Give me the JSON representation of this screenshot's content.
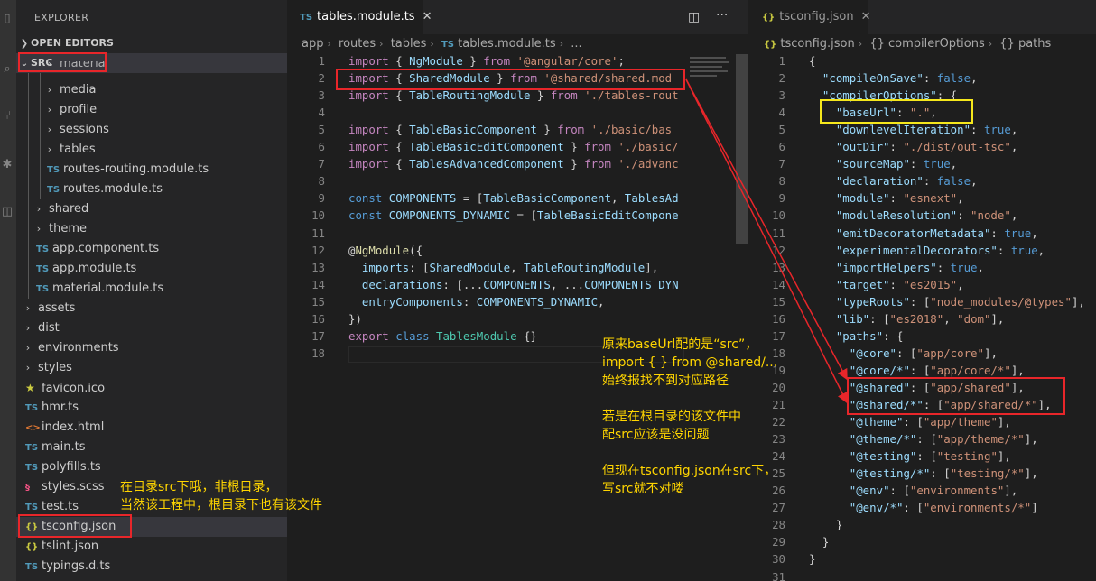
{
  "sidebar": {
    "title": "EXPLORER",
    "sections": {
      "open_editors": "OPEN EDITORS",
      "root": "SRC"
    },
    "tree": [
      {
        "label": "material",
        "type": "folder",
        "depth": 2
      },
      {
        "label": "media",
        "type": "folder",
        "depth": 2
      },
      {
        "label": "profile",
        "type": "folder",
        "depth": 2
      },
      {
        "label": "sessions",
        "type": "folder",
        "depth": 2
      },
      {
        "label": "tables",
        "type": "folder",
        "depth": 2
      },
      {
        "label": "routes-routing.module.ts",
        "type": "ts",
        "depth": 2
      },
      {
        "label": "routes.module.ts",
        "type": "ts",
        "depth": 2
      },
      {
        "label": "shared",
        "type": "folder",
        "depth": 1
      },
      {
        "label": "theme",
        "type": "folder",
        "depth": 1
      },
      {
        "label": "app.component.ts",
        "type": "ts",
        "depth": 1
      },
      {
        "label": "app.module.ts",
        "type": "ts",
        "depth": 1
      },
      {
        "label": "material.module.ts",
        "type": "ts",
        "depth": 1
      },
      {
        "label": "assets",
        "type": "folder",
        "depth": 0
      },
      {
        "label": "dist",
        "type": "folder",
        "depth": 0
      },
      {
        "label": "environments",
        "type": "folder",
        "depth": 0
      },
      {
        "label": "styles",
        "type": "folder",
        "depth": 0
      },
      {
        "label": "favicon.ico",
        "type": "star",
        "depth": 0
      },
      {
        "label": "hmr.ts",
        "type": "ts",
        "depth": 0
      },
      {
        "label": "index.html",
        "type": "html",
        "depth": 0
      },
      {
        "label": "main.ts",
        "type": "ts",
        "depth": 0
      },
      {
        "label": "polyfills.ts",
        "type": "ts",
        "depth": 0
      },
      {
        "label": "styles.scss",
        "type": "scss",
        "depth": 0
      },
      {
        "label": "test.ts",
        "type": "ts",
        "depth": 0
      },
      {
        "label": "tsconfig.json",
        "type": "json",
        "depth": 0
      },
      {
        "label": "tslint.json",
        "type": "json",
        "depth": 0
      },
      {
        "label": "typings.d.ts",
        "type": "ts",
        "depth": 0
      }
    ],
    "icon_text": {
      "ts": "TS",
      "json": "{}",
      "html": "<>",
      "scss": "§",
      "star": "★"
    }
  },
  "editor_left": {
    "tab_label": "tables.module.ts",
    "tab_icon": "TS",
    "breadcrumb": [
      "app",
      "routes",
      "tables",
      "tables.module.ts",
      "..."
    ],
    "line_numbers": [
      "1",
      "2",
      "3",
      "4",
      "5",
      "6",
      "7",
      "8",
      "9",
      "10",
      "11",
      "12",
      "13",
      "14",
      "15",
      "16",
      "17",
      "18"
    ],
    "lines": [
      [
        {
          "t": "import",
          "c": "kw"
        },
        {
          "t": " { ",
          "c": "txt"
        },
        {
          "t": "NgModule",
          "c": "vr"
        },
        {
          "t": " } ",
          "c": "txt"
        },
        {
          "t": "from",
          "c": "kw"
        },
        {
          "t": " ",
          "c": "txt"
        },
        {
          "t": "'@angular/core'",
          "c": "str"
        },
        {
          "t": ";",
          "c": "txt"
        }
      ],
      [
        {
          "t": "import",
          "c": "kw"
        },
        {
          "t": " { ",
          "c": "txt"
        },
        {
          "t": "SharedModule",
          "c": "vr"
        },
        {
          "t": " } ",
          "c": "txt"
        },
        {
          "t": "from",
          "c": "kw"
        },
        {
          "t": " ",
          "c": "txt"
        },
        {
          "t": "'@shared/shared.mod",
          "c": "str"
        }
      ],
      [
        {
          "t": "import",
          "c": "kw"
        },
        {
          "t": " { ",
          "c": "txt"
        },
        {
          "t": "TableRoutingModule",
          "c": "vr"
        },
        {
          "t": " } ",
          "c": "txt"
        },
        {
          "t": "from",
          "c": "kw"
        },
        {
          "t": " ",
          "c": "txt"
        },
        {
          "t": "'./tables-rout",
          "c": "str"
        }
      ],
      [],
      [
        {
          "t": "import",
          "c": "kw"
        },
        {
          "t": " { ",
          "c": "txt"
        },
        {
          "t": "TableBasicComponent",
          "c": "vr"
        },
        {
          "t": " } ",
          "c": "txt"
        },
        {
          "t": "from",
          "c": "kw"
        },
        {
          "t": " ",
          "c": "txt"
        },
        {
          "t": "'./basic/bas",
          "c": "str"
        }
      ],
      [
        {
          "t": "import",
          "c": "kw"
        },
        {
          "t": " { ",
          "c": "txt"
        },
        {
          "t": "TableBasicEditComponent",
          "c": "vr"
        },
        {
          "t": " } ",
          "c": "txt"
        },
        {
          "t": "from",
          "c": "kw"
        },
        {
          "t": " ",
          "c": "txt"
        },
        {
          "t": "'./basic/",
          "c": "str"
        }
      ],
      [
        {
          "t": "import",
          "c": "kw"
        },
        {
          "t": " { ",
          "c": "txt"
        },
        {
          "t": "TablesAdvancedComponent",
          "c": "vr"
        },
        {
          "t": " } ",
          "c": "txt"
        },
        {
          "t": "from",
          "c": "kw"
        },
        {
          "t": " ",
          "c": "txt"
        },
        {
          "t": "'./advanc",
          "c": "str"
        }
      ],
      [],
      [
        {
          "t": "const",
          "c": "kb"
        },
        {
          "t": " ",
          "c": "txt"
        },
        {
          "t": "COMPONENTS",
          "c": "vr"
        },
        {
          "t": " = [",
          "c": "txt"
        },
        {
          "t": "TableBasicComponent",
          "c": "vr"
        },
        {
          "t": ", ",
          "c": "txt"
        },
        {
          "t": "TablesAd",
          "c": "vr"
        }
      ],
      [
        {
          "t": "const",
          "c": "kb"
        },
        {
          "t": " ",
          "c": "txt"
        },
        {
          "t": "COMPONENTS_DYNAMIC",
          "c": "vr"
        },
        {
          "t": " = [",
          "c": "txt"
        },
        {
          "t": "TableBasicEditCompone",
          "c": "vr"
        }
      ],
      [],
      [
        {
          "t": "@",
          "c": "txt"
        },
        {
          "t": "NgModule",
          "c": "fn"
        },
        {
          "t": "({",
          "c": "txt"
        }
      ],
      [
        {
          "t": "  ",
          "c": "txt"
        },
        {
          "t": "imports",
          "c": "vr"
        },
        {
          "t": ": [",
          "c": "txt"
        },
        {
          "t": "SharedModule",
          "c": "vr"
        },
        {
          "t": ", ",
          "c": "txt"
        },
        {
          "t": "TableRoutingModule",
          "c": "vr"
        },
        {
          "t": "],",
          "c": "txt"
        }
      ],
      [
        {
          "t": "  ",
          "c": "txt"
        },
        {
          "t": "declarations",
          "c": "vr"
        },
        {
          "t": ": [...",
          "c": "txt"
        },
        {
          "t": "COMPONENTS",
          "c": "vr"
        },
        {
          "t": ", ...",
          "c": "txt"
        },
        {
          "t": "COMPONENTS_DYN",
          "c": "vr"
        }
      ],
      [
        {
          "t": "  ",
          "c": "txt"
        },
        {
          "t": "entryComponents",
          "c": "vr"
        },
        {
          "t": ": ",
          "c": "txt"
        },
        {
          "t": "COMPONENTS_DYNAMIC",
          "c": "vr"
        },
        {
          "t": ",",
          "c": "txt"
        }
      ],
      [
        {
          "t": "})",
          "c": "txt"
        }
      ],
      [
        {
          "t": "export",
          "c": "kw"
        },
        {
          "t": " ",
          "c": "txt"
        },
        {
          "t": "class",
          "c": "kb"
        },
        {
          "t": " ",
          "c": "txt"
        },
        {
          "t": "TablesModule",
          "c": "cls"
        },
        {
          "t": " {}",
          "c": "txt"
        }
      ],
      []
    ]
  },
  "editor_right": {
    "tab_label": "tsconfig.json",
    "tab_icon": "{}",
    "breadcrumb": [
      "tsconfig.json",
      "{} compilerOptions",
      "{} paths"
    ],
    "line_numbers": [
      "1",
      "2",
      "3",
      "4",
      "5",
      "6",
      "7",
      "8",
      "9",
      "10",
      "11",
      "12",
      "13",
      "14",
      "15",
      "16",
      "17",
      "18",
      "19",
      "20",
      "21",
      "22",
      "23",
      "24",
      "25",
      "26",
      "27",
      "28",
      "29",
      "30",
      "31"
    ],
    "lines": [
      [
        {
          "t": "{",
          "c": "txt"
        }
      ],
      [
        {
          "t": "  ",
          "c": "txt"
        },
        {
          "t": "\"compileOnSave\"",
          "c": "vr"
        },
        {
          "t": ": ",
          "c": "txt"
        },
        {
          "t": "false",
          "c": "kb"
        },
        {
          "t": ",",
          "c": "txt"
        }
      ],
      [
        {
          "t": "  ",
          "c": "txt"
        },
        {
          "t": "\"compilerOptions\"",
          "c": "vr"
        },
        {
          "t": ": {",
          "c": "txt"
        }
      ],
      [
        {
          "t": "    ",
          "c": "txt"
        },
        {
          "t": "\"baseUrl\"",
          "c": "vr"
        },
        {
          "t": ": ",
          "c": "txt"
        },
        {
          "t": "\".\"",
          "c": "str"
        },
        {
          "t": ",",
          "c": "txt"
        }
      ],
      [
        {
          "t": "    ",
          "c": "txt"
        },
        {
          "t": "\"downlevelIteration\"",
          "c": "vr"
        },
        {
          "t": ": ",
          "c": "txt"
        },
        {
          "t": "true",
          "c": "kb"
        },
        {
          "t": ",",
          "c": "txt"
        }
      ],
      [
        {
          "t": "    ",
          "c": "txt"
        },
        {
          "t": "\"outDir\"",
          "c": "vr"
        },
        {
          "t": ": ",
          "c": "txt"
        },
        {
          "t": "\"./dist/out-tsc\"",
          "c": "str"
        },
        {
          "t": ",",
          "c": "txt"
        }
      ],
      [
        {
          "t": "    ",
          "c": "txt"
        },
        {
          "t": "\"sourceMap\"",
          "c": "vr"
        },
        {
          "t": ": ",
          "c": "txt"
        },
        {
          "t": "true",
          "c": "kb"
        },
        {
          "t": ",",
          "c": "txt"
        }
      ],
      [
        {
          "t": "    ",
          "c": "txt"
        },
        {
          "t": "\"declaration\"",
          "c": "vr"
        },
        {
          "t": ": ",
          "c": "txt"
        },
        {
          "t": "false",
          "c": "kb"
        },
        {
          "t": ",",
          "c": "txt"
        }
      ],
      [
        {
          "t": "    ",
          "c": "txt"
        },
        {
          "t": "\"module\"",
          "c": "vr"
        },
        {
          "t": ": ",
          "c": "txt"
        },
        {
          "t": "\"esnext\"",
          "c": "str"
        },
        {
          "t": ",",
          "c": "txt"
        }
      ],
      [
        {
          "t": "    ",
          "c": "txt"
        },
        {
          "t": "\"moduleResolution\"",
          "c": "vr"
        },
        {
          "t": ": ",
          "c": "txt"
        },
        {
          "t": "\"node\"",
          "c": "str"
        },
        {
          "t": ",",
          "c": "txt"
        }
      ],
      [
        {
          "t": "    ",
          "c": "txt"
        },
        {
          "t": "\"emitDecoratorMetadata\"",
          "c": "vr"
        },
        {
          "t": ": ",
          "c": "txt"
        },
        {
          "t": "true",
          "c": "kb"
        },
        {
          "t": ",",
          "c": "txt"
        }
      ],
      [
        {
          "t": "    ",
          "c": "txt"
        },
        {
          "t": "\"experimentalDecorators\"",
          "c": "vr"
        },
        {
          "t": ": ",
          "c": "txt"
        },
        {
          "t": "true",
          "c": "kb"
        },
        {
          "t": ",",
          "c": "txt"
        }
      ],
      [
        {
          "t": "    ",
          "c": "txt"
        },
        {
          "t": "\"importHelpers\"",
          "c": "vr"
        },
        {
          "t": ": ",
          "c": "txt"
        },
        {
          "t": "true",
          "c": "kb"
        },
        {
          "t": ",",
          "c": "txt"
        }
      ],
      [
        {
          "t": "    ",
          "c": "txt"
        },
        {
          "t": "\"target\"",
          "c": "vr"
        },
        {
          "t": ": ",
          "c": "txt"
        },
        {
          "t": "\"es2015\"",
          "c": "str"
        },
        {
          "t": ",",
          "c": "txt"
        }
      ],
      [
        {
          "t": "    ",
          "c": "txt"
        },
        {
          "t": "\"typeRoots\"",
          "c": "vr"
        },
        {
          "t": ": [",
          "c": "txt"
        },
        {
          "t": "\"node_modules/@types\"",
          "c": "str"
        },
        {
          "t": "],",
          "c": "txt"
        }
      ],
      [
        {
          "t": "    ",
          "c": "txt"
        },
        {
          "t": "\"lib\"",
          "c": "vr"
        },
        {
          "t": ": [",
          "c": "txt"
        },
        {
          "t": "\"es2018\"",
          "c": "str"
        },
        {
          "t": ", ",
          "c": "txt"
        },
        {
          "t": "\"dom\"",
          "c": "str"
        },
        {
          "t": "],",
          "c": "txt"
        }
      ],
      [
        {
          "t": "    ",
          "c": "txt"
        },
        {
          "t": "\"paths\"",
          "c": "vr"
        },
        {
          "t": ": {",
          "c": "txt"
        }
      ],
      [
        {
          "t": "      ",
          "c": "txt"
        },
        {
          "t": "\"@core\"",
          "c": "vr"
        },
        {
          "t": ": [",
          "c": "txt"
        },
        {
          "t": "\"app/core\"",
          "c": "str"
        },
        {
          "t": "],",
          "c": "txt"
        }
      ],
      [
        {
          "t": "      ",
          "c": "txt"
        },
        {
          "t": "\"@core/*\"",
          "c": "vr"
        },
        {
          "t": ": [",
          "c": "txt"
        },
        {
          "t": "\"app/core/*\"",
          "c": "str"
        },
        {
          "t": "],",
          "c": "txt"
        }
      ],
      [
        {
          "t": "      ",
          "c": "txt"
        },
        {
          "t": "\"@shared\"",
          "c": "vr"
        },
        {
          "t": ": [",
          "c": "txt"
        },
        {
          "t": "\"app/shared\"",
          "c": "str"
        },
        {
          "t": "],",
          "c": "txt"
        }
      ],
      [
        {
          "t": "      ",
          "c": "txt"
        },
        {
          "t": "\"@shared/*\"",
          "c": "vr"
        },
        {
          "t": ": [",
          "c": "txt"
        },
        {
          "t": "\"app/shared/*\"",
          "c": "str"
        },
        {
          "t": "],",
          "c": "txt"
        }
      ],
      [
        {
          "t": "      ",
          "c": "txt"
        },
        {
          "t": "\"@theme\"",
          "c": "vr"
        },
        {
          "t": ": [",
          "c": "txt"
        },
        {
          "t": "\"app/theme\"",
          "c": "str"
        },
        {
          "t": "],",
          "c": "txt"
        }
      ],
      [
        {
          "t": "      ",
          "c": "txt"
        },
        {
          "t": "\"@theme/*\"",
          "c": "vr"
        },
        {
          "t": ": [",
          "c": "txt"
        },
        {
          "t": "\"app/theme/*\"",
          "c": "str"
        },
        {
          "t": "],",
          "c": "txt"
        }
      ],
      [
        {
          "t": "      ",
          "c": "txt"
        },
        {
          "t": "\"@testing\"",
          "c": "vr"
        },
        {
          "t": ": [",
          "c": "txt"
        },
        {
          "t": "\"testing\"",
          "c": "str"
        },
        {
          "t": "],",
          "c": "txt"
        }
      ],
      [
        {
          "t": "      ",
          "c": "txt"
        },
        {
          "t": "\"@testing/*\"",
          "c": "vr"
        },
        {
          "t": ": [",
          "c": "txt"
        },
        {
          "t": "\"testing/*\"",
          "c": "str"
        },
        {
          "t": "],",
          "c": "txt"
        }
      ],
      [
        {
          "t": "      ",
          "c": "txt"
        },
        {
          "t": "\"@env\"",
          "c": "vr"
        },
        {
          "t": ": [",
          "c": "txt"
        },
        {
          "t": "\"environments\"",
          "c": "str"
        },
        {
          "t": "],",
          "c": "txt"
        }
      ],
      [
        {
          "t": "      ",
          "c": "txt"
        },
        {
          "t": "\"@env/*\"",
          "c": "vr"
        },
        {
          "t": ": [",
          "c": "txt"
        },
        {
          "t": "\"environments/*\"",
          "c": "str"
        },
        {
          "t": "]",
          "c": "txt"
        }
      ],
      [
        {
          "t": "    }",
          "c": "txt"
        }
      ],
      [
        {
          "t": "  }",
          "c": "txt"
        }
      ],
      [
        {
          "t": "}",
          "c": "txt"
        }
      ],
      []
    ]
  },
  "annotations": {
    "note_baseurl": [
      "原来baseUrl配的是“src”，",
      "import { } from @shared/...",
      "始终报找不到对应路径",
      "",
      "若是在根目录的该文件中",
      "配src应该是没问题",
      "",
      "但现在tsconfig.json在src下，",
      "写src就不对喽"
    ],
    "note_src": [
      "在目录src下哦，非根目录，",
      "当然该工程中，根目录下也有该文件"
    ]
  },
  "colors": {
    "annotation_yellow": "#ffd500",
    "highlight_red": "#e8262a",
    "highlight_yellow": "#f5e71c",
    "ts_icon": "#519aba"
  }
}
